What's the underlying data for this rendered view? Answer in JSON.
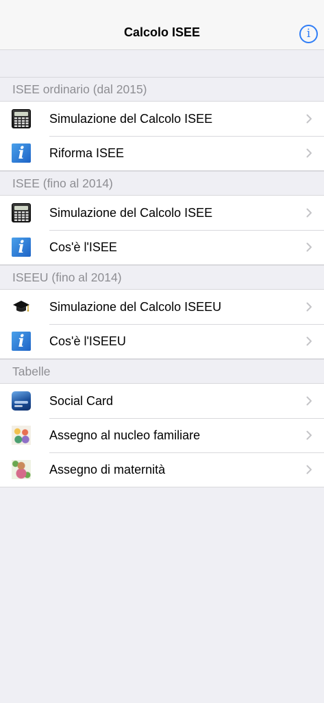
{
  "navbar": {
    "title": "Calcolo ISEE",
    "info_icon": "info-circle-icon",
    "info_glyph": "i",
    "accent_color": "#2f7df6"
  },
  "sections": [
    {
      "header": "ISEE ordinario (dal 2015)",
      "items": [
        {
          "label": "Simulazione del Calcolo ISEE",
          "icon": "calculator-icon"
        },
        {
          "label": "Riforma ISEE",
          "icon": "info-icon"
        }
      ]
    },
    {
      "header": "ISEE (fino al 2014)",
      "items": [
        {
          "label": "Simulazione del Calcolo ISEE",
          "icon": "calculator-icon"
        },
        {
          "label": "Cos'è l'ISEE",
          "icon": "info-icon"
        }
      ]
    },
    {
      "header": "ISEEU (fino al 2014)",
      "items": [
        {
          "label": "Simulazione del Calcolo ISEEU",
          "icon": "graduation-cap-icon"
        },
        {
          "label": "Cos'è l'ISEEU",
          "icon": "info-icon"
        }
      ]
    },
    {
      "header": "Tabelle",
      "items": [
        {
          "label": "Social Card",
          "icon": "social-card-icon"
        },
        {
          "label": "Assegno al nucleo familiare",
          "icon": "family-icon"
        },
        {
          "label": "Assegno di maternità",
          "icon": "maternity-icon"
        }
      ]
    }
  ]
}
